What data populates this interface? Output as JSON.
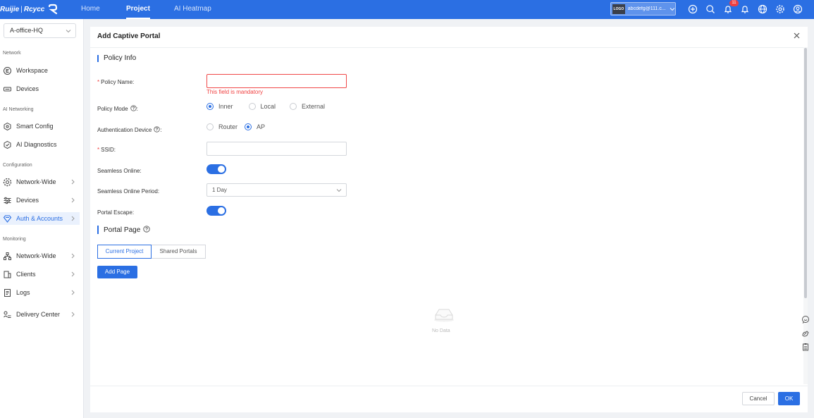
{
  "topbar": {
    "brand_name": "Ruijie",
    "brand_sep": "|",
    "brand_sub": "Rcycc",
    "tabs": [
      {
        "label": "Home",
        "active": false
      },
      {
        "label": "Project",
        "active": true
      },
      {
        "label": "AI Heatmap",
        "active": false
      }
    ],
    "account": {
      "logo_text": "LOGO",
      "name": "abcdefg@111.c..."
    },
    "notification_count": "11",
    "icons": [
      "add-circle-icon",
      "search-icon",
      "notification-bell-icon",
      "bell-icon",
      "globe-icon",
      "settings-icon",
      "user-icon"
    ],
    "color": "#2b6fe3"
  },
  "sidebar": {
    "project": "A-office-HQ",
    "sections": [
      {
        "title": "Network",
        "items": [
          {
            "label": "Workspace",
            "icon": "workspace-icon",
            "arrow": false
          },
          {
            "label": "Devices",
            "icon": "devices-icon",
            "arrow": false
          }
        ]
      },
      {
        "title": "AI Networking",
        "items": [
          {
            "label": "Smart Config",
            "icon": "smart-config-icon",
            "arrow": false
          },
          {
            "label": "AI Diagnostics",
            "icon": "ai-diagnostics-icon",
            "arrow": false
          }
        ]
      },
      {
        "title": "Configuration",
        "items": [
          {
            "label": "Network-Wide",
            "icon": "network-wide-icon",
            "arrow": true
          },
          {
            "label": "Devices",
            "icon": "devices-sliders-icon",
            "arrow": true
          },
          {
            "label": "Auth & Accounts",
            "icon": "auth-shield-icon",
            "arrow": true,
            "active": true
          }
        ]
      },
      {
        "title": "Monitoring",
        "items": [
          {
            "label": "Network-Wide",
            "icon": "topology-icon",
            "arrow": true
          },
          {
            "label": "Clients",
            "icon": "clients-icon",
            "arrow": true
          },
          {
            "label": "Logs",
            "icon": "logs-icon",
            "arrow": true
          }
        ]
      }
    ],
    "delivery_center": "Delivery Center"
  },
  "dialog": {
    "title": "Add Captive Portal",
    "policy_info": "Policy Info",
    "fields": {
      "policy_name": {
        "label": "Policy Name",
        "required": "*",
        "colon": ":",
        "value": "",
        "error": "This field is mandatory"
      },
      "policy_mode": {
        "label": "Policy Mode",
        "colon": ":",
        "options": [
          "Inner",
          "Local",
          "External"
        ],
        "selected": "Inner"
      },
      "auth_device": {
        "label": "Authentication Device",
        "colon": ":",
        "options": [
          "Router",
          "AP"
        ],
        "selected": "AP"
      },
      "ssid": {
        "label": "SSID",
        "required": "*",
        "colon": ":",
        "value": ""
      },
      "seamless_online": {
        "label": "Seamless Online",
        "colon": ":",
        "enabled": true
      },
      "seamless_period": {
        "label": "Seamless Online Period",
        "colon": ":",
        "value": "1 Day"
      },
      "portal_escape": {
        "label": "Portal Escape",
        "colon": ":",
        "enabled": true
      }
    },
    "portal_page": "Portal Page",
    "portal_tabs": [
      "Current Project",
      "Shared Portals"
    ],
    "portal_tab_selected": "Current Project",
    "add_page": "Add Page",
    "empty_text": "No Data",
    "cancel": "Cancel",
    "ok": "OK"
  }
}
